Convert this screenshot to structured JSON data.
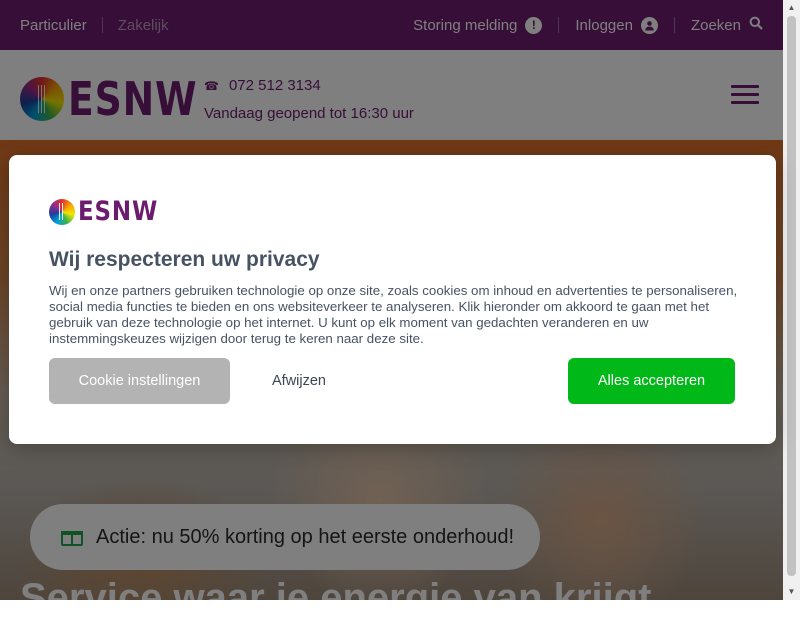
{
  "topbar": {
    "segments": [
      "Particulier",
      "Zakelijk"
    ],
    "links": {
      "storing": "Storing melding",
      "login": "Inloggen",
      "search": "Zoeken"
    },
    "icons": {
      "storing": "exclamation-icon",
      "login": "user-icon",
      "search": "search-icon"
    }
  },
  "header": {
    "logo_text": "ESNW",
    "phone": "072 512 3134",
    "hours": "Vandaag geopend tot 16:30 uur",
    "icons": {
      "phone": "phone-icon",
      "menu": "hamburger-menu-icon"
    }
  },
  "hero": {
    "promo": "Actie: nu 50% korting op het eerste onderhoud!",
    "promo_icon": "gift-icon",
    "title": "Service waar je energie van krijgt"
  },
  "consent": {
    "logo_text": "ESNW",
    "title": "Wij respecteren uw privacy",
    "body": "Wij en onze partners gebruiken technologie op onze site, zoals cookies om inhoud en advertenties te personaliseren, social media functies te bieden en ons websiteverkeer te analyseren. Klik hieronder om akkoord te gaan met het gebruik van deze technologie op het internet. U kunt op elk moment van gedachten veranderen en uw instemmingskeuzes wijzigen door terug te keren naar deze site.",
    "buttons": {
      "settings": "Cookie instellingen",
      "reject": "Afwijzen",
      "accept": "Alles accepteren"
    }
  },
  "colors": {
    "brand": "#6c1c6f",
    "accept": "#00b817",
    "settings_button": "#b3b3b3",
    "dialog_text": "#475363"
  }
}
